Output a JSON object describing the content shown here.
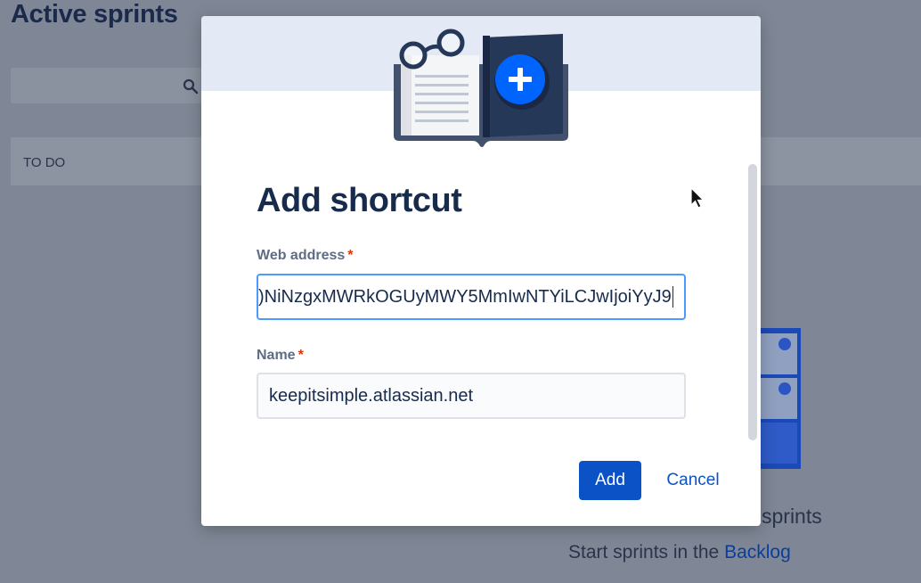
{
  "background": {
    "page_title": "Active sprints",
    "search_icon": "search-icon",
    "column_label": "TO DO",
    "empty_state": {
      "title": "sprints",
      "text_prefix": "Start sprints in the ",
      "link": "Backlog"
    }
  },
  "modal": {
    "illustration": "book-with-glasses-and-plus-icon",
    "title": "Add shortcut",
    "web_address": {
      "label": "Web address",
      "required_mark": "*",
      "value": ")NiNzgxMWRkOGUyMWY5MmIwNTYiLCJwIjoiYyJ9"
    },
    "name": {
      "label": "Name",
      "required_mark": "*",
      "value": "keepitsimple.atlassian.net"
    },
    "add_label": "Add",
    "cancel_label": "Cancel"
  },
  "colors": {
    "primary": "#0b52c7",
    "title": "#172b4d",
    "required": "#de350b",
    "focus_border": "#4c9aff"
  }
}
